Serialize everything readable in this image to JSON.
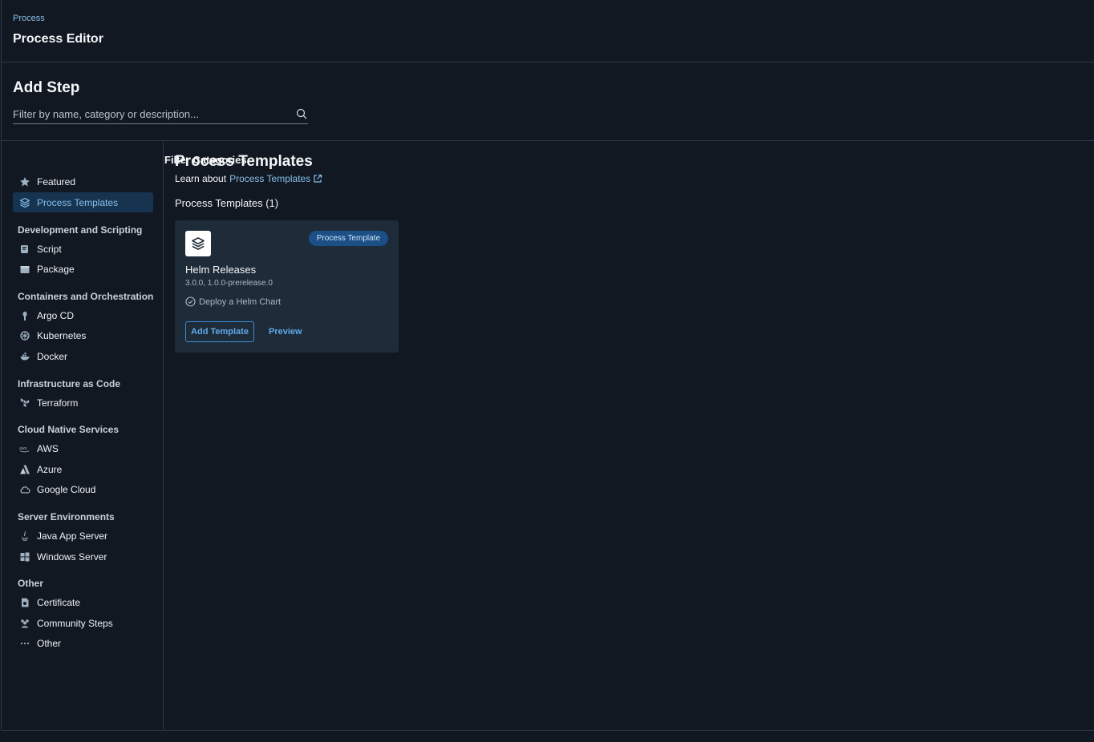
{
  "header": {
    "breadcrumb": "Process",
    "title": "Process Editor"
  },
  "add_step": {
    "title": "Add Step",
    "search": {
      "placeholder": "Filter by name, category or description...",
      "value": ""
    }
  },
  "sidebar": {
    "heading": "Filter Categories",
    "top_items": [
      {
        "label": "Featured",
        "icon": "star-icon"
      },
      {
        "label": "Process Templates",
        "icon": "layers-icon",
        "active": true
      }
    ],
    "groups": [
      {
        "heading": "Development and Scripting",
        "items": [
          {
            "label": "Script",
            "icon": "script-icon"
          },
          {
            "label": "Package",
            "icon": "package-icon"
          }
        ]
      },
      {
        "heading": "Containers and Orchestration",
        "items": [
          {
            "label": "Argo CD",
            "icon": "argo-icon"
          },
          {
            "label": "Kubernetes",
            "icon": "kubernetes-icon"
          },
          {
            "label": "Docker",
            "icon": "docker-icon"
          }
        ]
      },
      {
        "heading": "Infrastructure as Code",
        "items": [
          {
            "label": "Terraform",
            "icon": "terraform-icon"
          }
        ]
      },
      {
        "heading": "Cloud Native Services",
        "items": [
          {
            "label": "AWS",
            "icon": "aws-icon"
          },
          {
            "label": "Azure",
            "icon": "azure-icon"
          },
          {
            "label": "Google Cloud",
            "icon": "cloud-icon"
          }
        ]
      },
      {
        "heading": "Server Environments",
        "items": [
          {
            "label": "Java App Server",
            "icon": "java-icon"
          },
          {
            "label": "Windows Server",
            "icon": "windows-icon"
          }
        ]
      },
      {
        "heading": "Other",
        "items": [
          {
            "label": "Certificate",
            "icon": "certificate-icon"
          },
          {
            "label": "Community Steps",
            "icon": "users-icon"
          },
          {
            "label": "Other",
            "icon": "ellipsis-icon"
          }
        ]
      }
    ]
  },
  "main": {
    "title": "Process Templates",
    "learn_prefix": "Learn about",
    "learn_link": "Process Templates",
    "section_heading": "Process Templates (1)",
    "card": {
      "badge": "Process Template",
      "name": "Helm Releases",
      "versions": "3.0.0, 1.0.0-prerelease.0",
      "step": "Deploy a Helm Chart",
      "add_label": "Add Template",
      "preview_label": "Preview"
    }
  },
  "colors": {
    "background": "#111821",
    "accent": "#5fa8ea",
    "active_bg": "#163350",
    "card_bg": "#1e2b38",
    "badge_bg": "#1b4f86"
  }
}
